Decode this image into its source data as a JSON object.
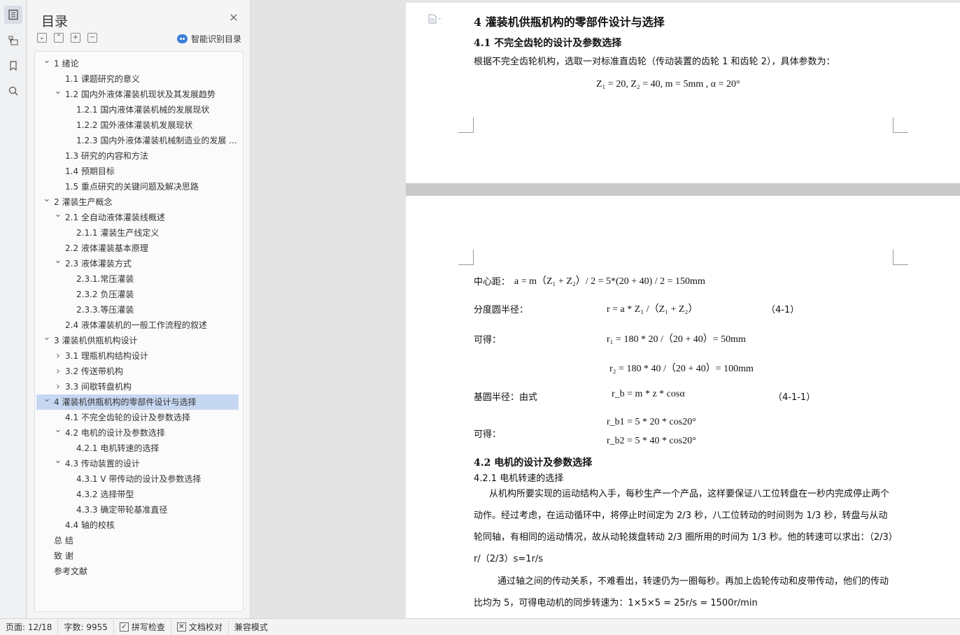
{
  "toc": {
    "title": "目录",
    "smart_label": "智能识别目录",
    "items": [
      {
        "level": 1,
        "chev": "down",
        "label": "1 绪论"
      },
      {
        "level": 2,
        "chev": "",
        "label": "1.1 课题研究的意义"
      },
      {
        "level": 2,
        "chev": "down",
        "label": "1.2 国内外液体灌装机现状及其发展趋势"
      },
      {
        "level": 3,
        "chev": "",
        "label": "1.2.1 国内液体灌装机械的发展现状"
      },
      {
        "level": 3,
        "chev": "",
        "label": "1.2.2 国外液体灌装机发展现状"
      },
      {
        "level": 3,
        "chev": "",
        "label": "1.2.3 国内外液体灌装机械制造业的发展 ..."
      },
      {
        "level": 2,
        "chev": "",
        "label": "1.3 研究的内容和方法"
      },
      {
        "level": 2,
        "chev": "",
        "label": "1.4 预期目标"
      },
      {
        "level": 2,
        "chev": "",
        "label": "1.5 重点研究的关键问题及解决思路"
      },
      {
        "level": 1,
        "chev": "down",
        "label": "2 灌装生产概念"
      },
      {
        "level": 2,
        "chev": "down",
        "label": "2.1 全自动液体灌装线概述"
      },
      {
        "level": 3,
        "chev": "",
        "label": "2.1.1 灌装生产线定义"
      },
      {
        "level": 2,
        "chev": "",
        "label": "2.2  液体灌装基本原理"
      },
      {
        "level": 2,
        "chev": "down",
        "label": "2.3 液体灌装方式"
      },
      {
        "level": 3,
        "chev": "",
        "label": "2.3.1.常压灌装"
      },
      {
        "level": 3,
        "chev": "",
        "label": "2.3.2 负压灌装"
      },
      {
        "level": 3,
        "chev": "",
        "label": "2.3.3.等压灌装"
      },
      {
        "level": 2,
        "chev": "",
        "label": "2.4 液体灌装机的一般工作流程的叙述"
      },
      {
        "level": 1,
        "chev": "down",
        "label": "3 灌装机供瓶机构设计"
      },
      {
        "level": 2,
        "chev": "right",
        "label": "3.1 理瓶机构结构设计"
      },
      {
        "level": 2,
        "chev": "right",
        "label": "3.2 传送带机构"
      },
      {
        "level": 2,
        "chev": "right",
        "label": "3.3  间歇转盘机构"
      },
      {
        "level": 1,
        "chev": "down",
        "label": "4 灌装机供瓶机构的零部件设计与选择",
        "active": true
      },
      {
        "level": 2,
        "chev": "",
        "label": "4.1 不完全齿轮的设计及参数选择"
      },
      {
        "level": 2,
        "chev": "down",
        "label": "4.2 电机的设计及参数选择"
      },
      {
        "level": 3,
        "chev": "",
        "label": "4.2.1  电机转速的选择"
      },
      {
        "level": 2,
        "chev": "down",
        "label": "4.3 传动装置的设计"
      },
      {
        "level": 3,
        "chev": "",
        "label": "4.3.1 V 带传动的设计及参数选择"
      },
      {
        "level": 3,
        "chev": "",
        "label": "4.3.2 选择带型"
      },
      {
        "level": 3,
        "chev": "",
        "label": "4.3.3 确定带轮基准直径"
      },
      {
        "level": 2,
        "chev": "",
        "label": "4.4 轴的校核"
      },
      {
        "level": 1,
        "chev": "none",
        "label": "总 结"
      },
      {
        "level": 1,
        "chev": "none",
        "label": "致 谢"
      },
      {
        "level": 1,
        "chev": "none",
        "label": "参考文献"
      }
    ]
  },
  "doc": {
    "page1": {
      "heading": "4 灌装机供瓶机构的零部件设计与选择",
      "sub": "4.1 不完全齿轮的设计及参数选择",
      "intro": "根据不完全齿轮机构，选取一对标准直齿轮（传动装置的齿轮 1 和齿轮 2），具体参数为：",
      "params": "Z₁ = 20,  Z₂ = 40,  m = 5mm ,   α = 20°"
    },
    "page2": {
      "center_label": "中心距：",
      "center_formula": "a = m（Z₁ + Z₂）/ 2 = 5*(20 + 40) / 2 = 150mm",
      "pitch_label": "分度圆半径：",
      "pitch_formula": "r  = a * Z₁ /（Z₁ + Z₂）",
      "pitch_num": "（4-1）",
      "gives1_label": "可得：",
      "r1_formula": "r₁ = 180 * 20 /（20 + 40）= 50mm",
      "r2_formula": "r₂ = 180 * 40 /（20 + 40）= 100mm",
      "base_label": "基圆半径：由式",
      "base_formula": "r_b = m * z  * cosα",
      "base_num": "（4-1-1）",
      "gives2_label": "可得：",
      "rb1_formula": "r_b1 = 5 * 20 * cos20°",
      "rb2_formula": "r_b2 = 5 * 40 * cos20°",
      "sec42": "4.2 电机的设计及参数选择",
      "sec421": "4.2.1 电机转速的选择",
      "para1": "从机构所要实现的运动结构入手，每秒生产一个产品，这样要保证八工位转盘在一秒内完成停止两个动作。经过考虑，在运动循环中，将停止时间定为 2/3 秒，八工位转动的时间则为 1/3 秒，转盘与从动轮同轴，有相同的运动情况，故从动轮拨盘转动 2/3 圈所用的时间为 1/3 秒。他的转速可以求出：（2/3）r/（2/3）s=1r/s",
      "para2": "通过轴之间的传动关系，不难看出，转速仍为一圈每秒。再加上齿轮传动和皮带传动，他们的传动比均为 5，可得电动机的同步转速为：1×5×5 = 25r/s = 1500r/min"
    }
  },
  "status": {
    "page": "页面: 12/18",
    "words": "字数: 9955",
    "spell": "拼写检查",
    "proof": "文档校对",
    "compat": "兼容模式"
  }
}
